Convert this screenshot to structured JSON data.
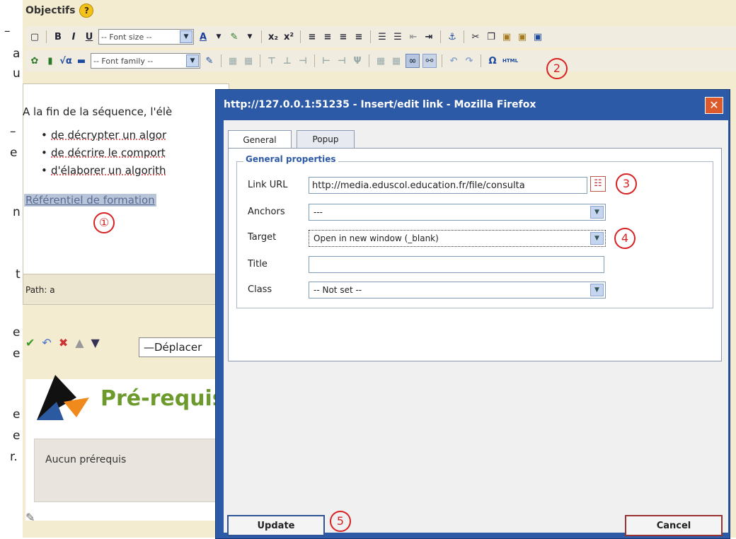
{
  "section": {
    "title": "Objectifs",
    "help": "?"
  },
  "left_edge": {
    "chars": [
      "–",
      "a",
      "u",
      "–",
      "e",
      "n",
      "t",
      "e",
      "e",
      "e",
      "e",
      "r."
    ]
  },
  "toolbar": {
    "font_size": "-- Font size --",
    "font_family": "-- Font family --",
    "icons": [
      "new-doc-icon",
      "bold-icon",
      "italic-icon",
      "underline-icon",
      "font-color-icon",
      "highlight-icon",
      "subscript-icon",
      "superscript-icon",
      "align-left-icon",
      "align-center-icon",
      "align-right-icon",
      "justify-icon",
      "bullet-list-icon",
      "numbered-list-icon",
      "outdent-icon",
      "indent-icon",
      "anchor-icon",
      "cut-icon",
      "copy-icon",
      "paste-icon",
      "paste-text-icon",
      "paste-word-icon"
    ],
    "html_label": "HTML"
  },
  "editor": {
    "intro": "A la fin de la séquence, l'élè",
    "bullets": [
      "de décrypter un algor",
      "de décrire le comport",
      "d'élaborer un algorith"
    ],
    "link": "Référentiel de formation",
    "path": "Path: a"
  },
  "markers": [
    "①",
    "2",
    "3",
    "4",
    "5"
  ],
  "bottom": {
    "move_select": "—Déplacer",
    "prereq_title": "Pré-requis",
    "prereq_text": "Aucun prérequis"
  },
  "dialog": {
    "title": "http://127.0.0.1:51235 - Insert/edit link - Mozilla Firefox",
    "close": "✕",
    "tabs": [
      "General",
      "Popup"
    ],
    "legend": "General properties",
    "fields": {
      "link_url_label": "Link URL",
      "link_url_value": "http://media.eduscol.education.fr/file/consulta",
      "anchors_label": "Anchors",
      "anchors_value": "---",
      "target_label": "Target",
      "target_value": "Open in new window (_blank)",
      "title_label": "Title",
      "title_value": "",
      "class_label": "Class",
      "class_value": "-- Not set --"
    },
    "update": "Update",
    "cancel": "Cancel"
  }
}
